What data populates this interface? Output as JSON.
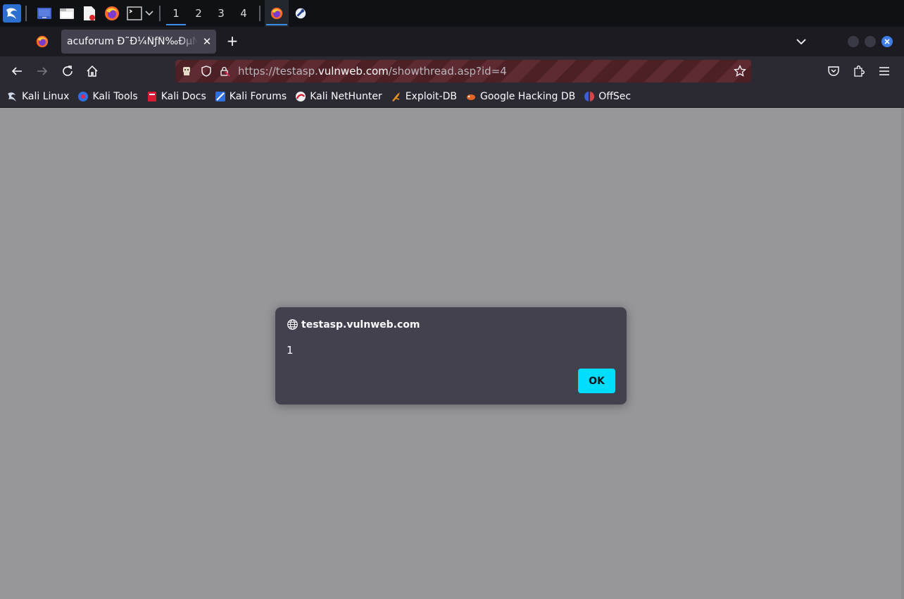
{
  "taskbar": {
    "workspaces": [
      "1",
      "2",
      "3",
      "4"
    ],
    "active_workspace": "1",
    "launchers": [
      "kali-menu-icon",
      "desktop-icon",
      "file-manager-icon",
      "text-editor-icon",
      "firefox-icon",
      "terminal-icon"
    ],
    "open_apps": [
      "firefox-icon",
      "kali-app-icon"
    ]
  },
  "browser": {
    "tab_title": "acuforum Ð˜Ð¼ÑƒÑ‰ÐµÑ",
    "tab_close": "✕",
    "new_tab": "+",
    "url_scheme": "https://testasp.",
    "url_host": "vulnweb.com",
    "url_path": "/showthread.asp?id=4"
  },
  "bookmarks": [
    {
      "label": "Kali Linux",
      "icon": "kali-dragon-icon"
    },
    {
      "label": "Kali Tools",
      "icon": "kali-tools-icon"
    },
    {
      "label": "Kali Docs",
      "icon": "kali-docs-icon"
    },
    {
      "label": "Kali Forums",
      "icon": "kali-forums-icon"
    },
    {
      "label": "Kali NetHunter",
      "icon": "nethunter-icon"
    },
    {
      "label": "Exploit-DB",
      "icon": "exploitdb-icon"
    },
    {
      "label": "Google Hacking DB",
      "icon": "ghdb-icon"
    },
    {
      "label": "OffSec",
      "icon": "offsec-icon"
    }
  ],
  "dialog": {
    "origin": "testasp.vulnweb.com",
    "message": "1",
    "ok_label": "OK"
  },
  "colors": {
    "accent": "#00ddff",
    "content_overlay": "#97979a",
    "dialog_bg": "#42414d"
  }
}
